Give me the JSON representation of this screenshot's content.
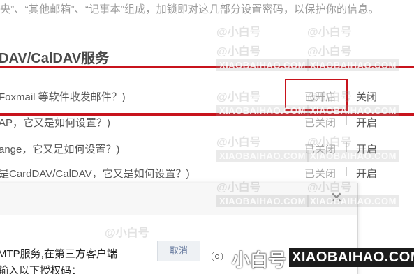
{
  "top_description": "央”、“其他邮箱”、“记事本”组成，加锁即对这几部分设置密码，以保护你的信息。",
  "section": {
    "title": "DAV/CalDAV服务"
  },
  "services": [
    {
      "label": "Foxmail 等软件收发邮件？)",
      "status": "已开启",
      "separator": "|",
      "action": "关闭"
    },
    {
      "label": "AP，它又是如何设置？)",
      "status": "已关闭",
      "separator": "|",
      "action": "开启"
    },
    {
      "label": "ange，它又是如何设置？)",
      "status": "已关闭",
      "separator": "|",
      "action": "开启"
    },
    {
      "label": "是CardDAV/CalDAV，它又是如何设置？)",
      "status": "已关闭",
      "separator": "|",
      "action": "开启"
    }
  ],
  "modal": {
    "close_glyph": "✕",
    "line1": "MTP服务,在第三方客户端",
    "line2": "输入以下授权码：",
    "cancel_label": "取消"
  },
  "watermark": {
    "handle": "@小白号",
    "url": "XIAOBAIHAO.COM"
  },
  "brand": {
    "name_cn": "小白号",
    "name_latin": "XIAOBAIHAO.COM",
    "icon": "radio-signal-icon"
  },
  "colors": {
    "highlight_red": "#c8131c",
    "status_gray": "#a6a6a6",
    "text_dark": "#555555"
  }
}
